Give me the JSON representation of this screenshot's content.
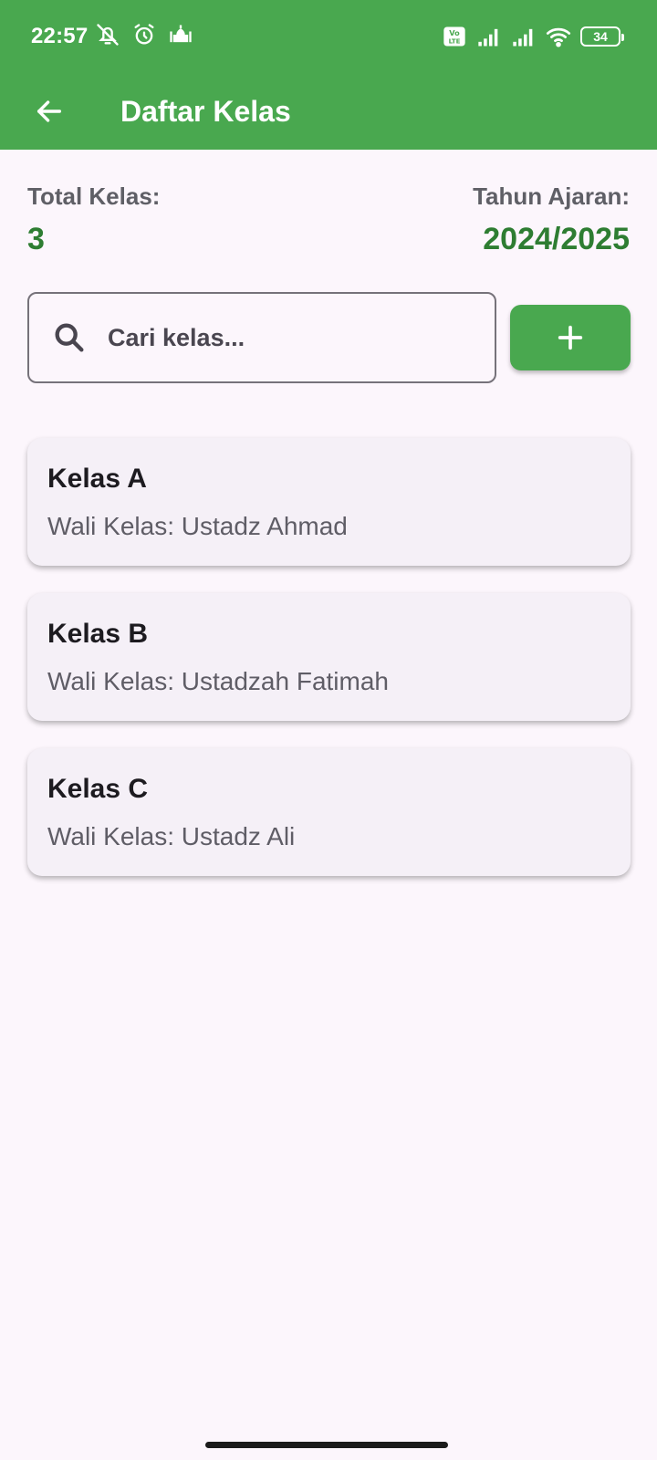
{
  "status_bar": {
    "time": "22:57",
    "battery": "34",
    "icons_left": [
      "mute-icon",
      "alarm-icon",
      "mosque-icon"
    ],
    "icons_right": [
      "volte-icon",
      "signal-icon",
      "signal-icon",
      "wifi-icon",
      "battery-icon"
    ]
  },
  "app_bar": {
    "title": "Daftar Kelas",
    "back_icon": "arrow-back-icon"
  },
  "summary": {
    "total_label": "Total Kelas:",
    "total_value": "3",
    "year_label": "Tahun Ajaran:",
    "year_value": "2024/2025"
  },
  "search": {
    "placeholder": "Cari kelas...",
    "value": "",
    "icon": "search-icon"
  },
  "add_button": {
    "icon": "plus-icon"
  },
  "classes": [
    {
      "name": "Kelas A",
      "teacher": "Wali Kelas: Ustadz Ahmad"
    },
    {
      "name": "Kelas B",
      "teacher": "Wali Kelas: Ustadzah Fatimah"
    },
    {
      "name": "Kelas C",
      "teacher": "Wali Kelas: Ustadz Ali"
    }
  ],
  "colors": {
    "primary": "#49a84f",
    "accent_text": "#2e7d32",
    "background": "#fcf6fc",
    "card": "#f5f0f7"
  }
}
